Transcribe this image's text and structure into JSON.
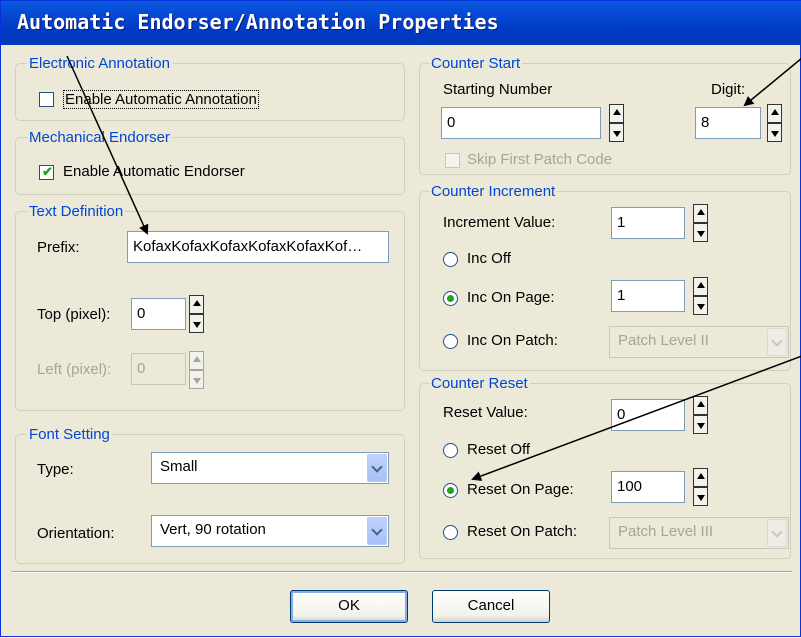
{
  "window": {
    "title": "Automatic Endorser/Annotation Properties"
  },
  "electronic_annotation": {
    "legend": "Electronic Annotation",
    "checkbox_label": "Enable Automatic Annotation",
    "checked": false
  },
  "mechanical_endorser": {
    "legend": "Mechanical Endorser",
    "checkbox_label": "Enable Automatic Endorser",
    "checked": true
  },
  "text_definition": {
    "legend": "Text Definition",
    "prefix_label": "Prefix:",
    "prefix_value": "KofaxKofaxKofaxKofaxKofaxKof…",
    "top_label": "Top (pixel):",
    "top_value": "0",
    "left_label": "Left (pixel):",
    "left_value": "0"
  },
  "font_setting": {
    "legend": "Font Setting",
    "type_label": "Type:",
    "type_value": "Small",
    "orientation_label": "Orientation:",
    "orientation_value": "Vert, 90 rotation"
  },
  "counter_start": {
    "legend": "Counter Start",
    "starting_number_label": "Starting Number",
    "starting_number_value": "0",
    "digit_label": "Digit:",
    "digit_value": "8",
    "skip_label": "Skip First Patch Code"
  },
  "counter_increment": {
    "legend": "Counter Increment",
    "increment_label": "Increment Value:",
    "increment_value": "1",
    "inc_off_label": "Inc Off",
    "inc_on_page_label": "Inc On Page:",
    "inc_on_page_value": "1",
    "inc_on_patch_label": "Inc On Patch:",
    "inc_on_patch_value": "Patch Level II",
    "selected": "inc_on_page"
  },
  "counter_reset": {
    "legend": "Counter Reset",
    "reset_value_label": "Reset Value:",
    "reset_value": "0",
    "reset_off_label": "Reset Off",
    "reset_on_page_label": "Reset On Page:",
    "reset_on_page_value": "100",
    "reset_on_patch_label": "Reset On Patch:",
    "reset_on_patch_value": "Patch Level III",
    "selected": "reset_on_page"
  },
  "buttons": {
    "ok": "OK",
    "cancel": "Cancel"
  },
  "colors": {
    "title_bar": "#0546d2",
    "legend_text": "#0046d5",
    "check_mark": "#21a121",
    "dialog_bg": "#ece9d8"
  }
}
